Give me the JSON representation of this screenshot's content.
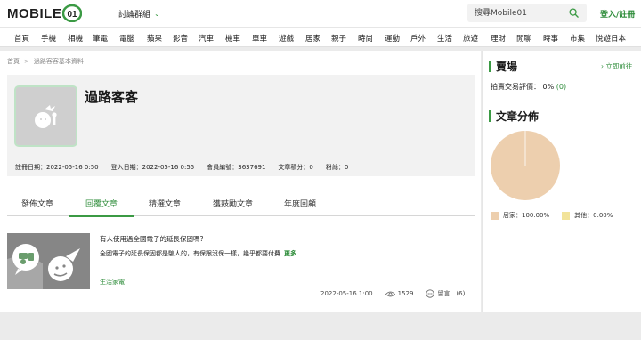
{
  "header": {
    "logo_text": "MOBILE",
    "logo_badge": "01",
    "forum_menu_label": "討論群組",
    "search_placeholder": "搜尋Mobile01",
    "login_label": "登入/註冊"
  },
  "nav": {
    "items": [
      "首頁",
      "手機",
      "相機",
      "筆電",
      "電腦",
      "蘋果",
      "影音",
      "汽車",
      "機車",
      "單車",
      "遊戲",
      "居家",
      "親子",
      "時尚",
      "運動",
      "戶外",
      "生活",
      "旅遊",
      "理財",
      "閒聊",
      "時事",
      "市集",
      "悅遊日本"
    ]
  },
  "breadcrumb": {
    "home": "首頁",
    "separator": ">",
    "current": "過路客客基本資料"
  },
  "profile": {
    "username": "過路客客",
    "stats": [
      "註冊日期：2022-05-16 0:50",
      "登入日期：2022-05-16 0:55",
      "會員編號：3637691",
      "文章積分：0",
      "粉絲：0"
    ]
  },
  "tabs": {
    "items": [
      "發佈文章",
      "回覆文章",
      "精選文章",
      "獲鼓勵文章",
      "年度回顧"
    ],
    "active_index": 1
  },
  "article": {
    "title": "有人使用過全國電子的延長保固嗎?",
    "excerpt": "全國電子的延長保固都是騙人的，有保跟沒保一樣，幾乎都要付費",
    "more_label": "更多",
    "category": "生活家電",
    "datetime": "2022-05-16 1:00",
    "views": "1529",
    "reply_label": "留言",
    "reply_count": "(6)"
  },
  "sidebar": {
    "market_title": "賣場",
    "go_link": "立即前往",
    "rating_label": "拍賣交易評價：",
    "rating_value": "0%",
    "rating_count": "(0)",
    "distribution_title": "文章分佈"
  },
  "chart_data": {
    "type": "pie",
    "title": "文章分佈",
    "categories": [
      "居家",
      "其他"
    ],
    "values": [
      100.0,
      0.0
    ],
    "labels": [
      "居家：100.00%",
      "其他：0.00%"
    ],
    "colors": [
      "#edcfae",
      "#f2e39a"
    ],
    "legend": "bottom"
  },
  "colors": {
    "brand_green": "#3b9a44",
    "link_green": "#2f8d3b",
    "page_bg": "#ebebeb"
  },
  "icons": {
    "search": "search-icon",
    "chevron": "chevron-down-icon",
    "eye": "eye-icon",
    "comment": "comment-icon"
  }
}
